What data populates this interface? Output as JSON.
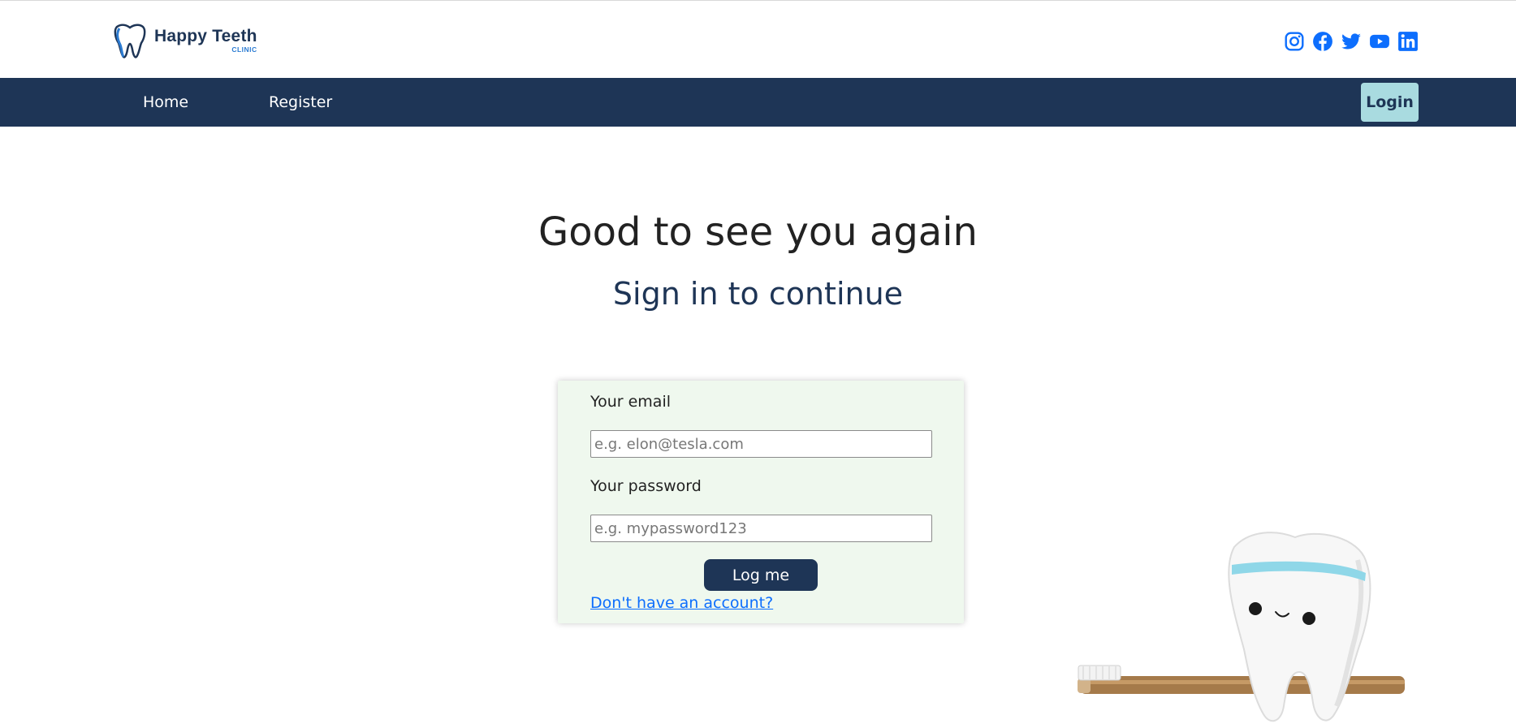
{
  "brand": {
    "name": "Happy Teeth",
    "sub": "CLINIC"
  },
  "social": [
    {
      "icon": "instagram-icon"
    },
    {
      "icon": "facebook-icon"
    },
    {
      "icon": "twitter-icon"
    },
    {
      "icon": "youtube-icon"
    },
    {
      "icon": "linkedin-icon"
    }
  ],
  "nav": {
    "home": "Home",
    "register": "Register",
    "login": "Login"
  },
  "main": {
    "title": "Good to see you again",
    "subtitle": "Sign in to continue"
  },
  "form": {
    "email_label": "Your email",
    "email_placeholder": "e.g. elon@tesla.com",
    "password_label": "Your password",
    "password_placeholder": "e.g. mypassword123",
    "submit_label": "Log me",
    "signup_link": "Don't have an account?"
  },
  "colors": {
    "navy": "#1e3556",
    "accent": "#a9dbe0",
    "social": "#0d6efd",
    "card_bg": "#eff8ee"
  }
}
